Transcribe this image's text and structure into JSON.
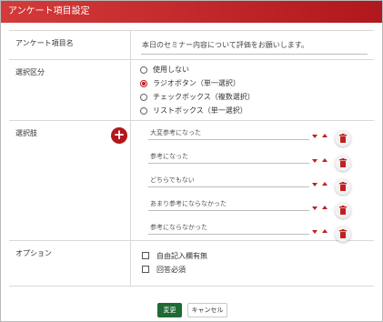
{
  "dialog": {
    "title": "アンケート項目設定"
  },
  "form": {
    "question_label": "アンケート項目名",
    "question_value": "本日のセミナー内容について評価をお願いします。",
    "type_label": "選択区分",
    "type_options": [
      {
        "label": "使用しない",
        "selected": false
      },
      {
        "label": "ラジオボタン（単一選択）",
        "selected": true
      },
      {
        "label": "チェックボックス（複数選択）",
        "selected": false
      },
      {
        "label": "リストボックス（単一選択）",
        "selected": false
      }
    ],
    "choices_label": "選択肢",
    "add_icon": "plus-icon",
    "choices": [
      "大変参考になった",
      "参考になった",
      "どちらでもない",
      "あまり参考にならなかった",
      "参考にならなかった"
    ],
    "options_label": "オプション",
    "options": [
      {
        "label": "自由記入欄有無",
        "checked": false
      },
      {
        "label": "回答必須",
        "checked": false
      }
    ]
  },
  "footer": {
    "confirm_label": "変更",
    "cancel_label": "キャンセル"
  },
  "colors": {
    "titlebar_start": "#d43a3a",
    "titlebar_end": "#b0181d",
    "accent_red": "#c0201f",
    "confirm_green": "#1e6b34"
  }
}
